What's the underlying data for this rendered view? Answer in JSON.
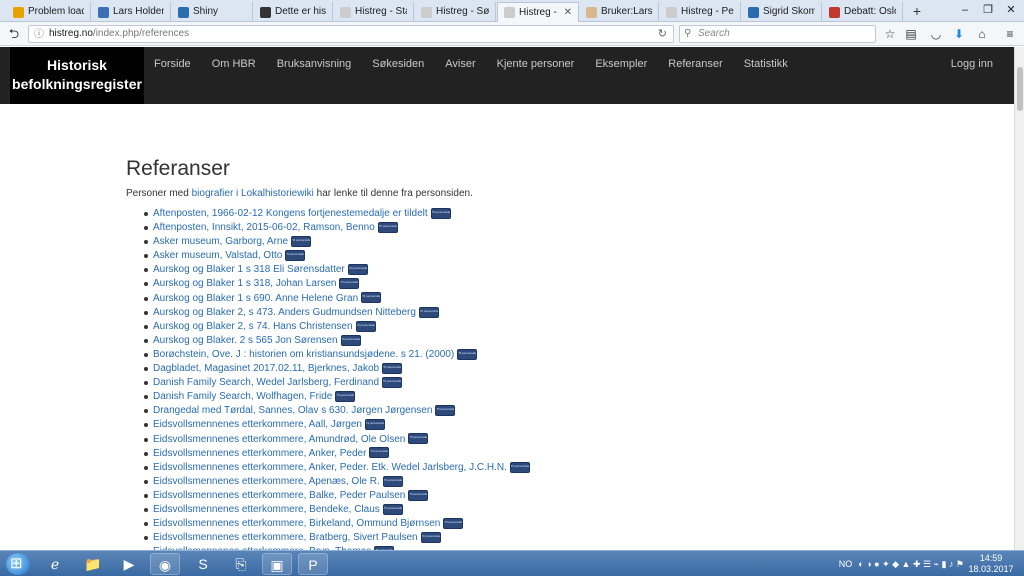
{
  "browser": {
    "tabs": [
      {
        "label": "Problem load…",
        "color": "#e8a200"
      },
      {
        "label": "Lars Holden -…",
        "color": "#3b6fb6"
      },
      {
        "label": "Shiny",
        "color": "#2a6cb0"
      },
      {
        "label": "Dette er histo…",
        "color": "#333333"
      },
      {
        "label": "Histreg - Statistikk",
        "color": "#cccccc"
      },
      {
        "label": "Histreg - Søkeres…",
        "color": "#cccccc"
      },
      {
        "label": "Histreg - Refer…",
        "color": "#cccccc"
      },
      {
        "label": "Bruker:Lars H…",
        "color": "#d9b98a"
      },
      {
        "label": "Histreg - Personsi…",
        "color": "#cccccc"
      },
      {
        "label": "Sigrid Skome…",
        "color": "#2a6cb0"
      },
      {
        "label": "Debatt: Oslo …",
        "color": "#c0392b"
      }
    ],
    "active_tab_index": 6,
    "new_tab_symbol": "+",
    "url_host": "histreg.no",
    "url_path": "/index.php/references",
    "search_placeholder": "Search"
  },
  "site": {
    "brand_line1": "Historisk",
    "brand_line2": "befolkningsregister",
    "nav": [
      "Forside",
      "Om HBR",
      "Bruksanvisning",
      "Søkesiden",
      "Aviser",
      "Kjente personer",
      "Eksempler",
      "Referanser",
      "Statistikk"
    ],
    "login": "Logg inn"
  },
  "page": {
    "title": "Referanser",
    "intro_before": "Personer med ",
    "intro_link": "biografier i Lokalhistoriewiki",
    "intro_after": " har lenke til denne fra personsiden.",
    "tag_label": "Til personside",
    "references": [
      "Aftenposten, 1966-02-12 Kongens fortjenestemedalje er tildelt",
      "Aftenposten, Innsikt, 2015-06-02, Ramson, Benno",
      "Asker museum, Garborg, Arne",
      "Asker museum, Valstad, Otto",
      "Aurskog og Blaker 1 s 318 Eli Sørensdatter",
      "Aurskog og Blaker 1 s 318, Johan Larsen",
      "Aurskog og Blaker 1 s 690. Anne Helene Gran",
      "Aurskog og Blaker 2, s 473. Anders Gudmundsen Nitteberg",
      "Aurskog og Blaker 2, s 74. Hans Christensen",
      "Aurskog og Blaker. 2 s 565 Jon Sørensen",
      "Borøchstein, Ove. J : historien om kristiansundsjødene. s 21. (2000)",
      "Dagbladet, Magasinet 2017.02.11, Bjerknes, Jakob",
      "Danish Family Search, Wedel Jarlsberg, Ferdinand",
      "Danish Family Search, Wolfhagen, Fride",
      "Drangedal med Tørdal, Sannes, Olav s 630. Jørgen Jørgensen",
      "Eidsvollsmennenes etterkommere, Aall, Jørgen",
      "Eidsvollsmennenes etterkommere, Amundrød, Ole Olsen",
      "Eidsvollsmennenes etterkommere, Anker, Peder",
      "Eidsvollsmennenes etterkommere, Anker, Peder. Etk. Wedel Jarlsberg, J.C.H.N.",
      "Eidsvollsmennenes etterkommere, Apenæs, Ole R.",
      "Eidsvollsmennenes etterkommere, Balke, Peder Paulsen",
      "Eidsvollsmennenes etterkommere, Bendeke, Claus",
      "Eidsvollsmennenes etterkommere, Birkeland, Ommund Bjørnsen",
      "Eidsvollsmennenes etterkommere, Bratberg, Sivert Paulsen",
      "Eidsvollsmennenes etterkommere, Bryn, Thomas"
    ]
  },
  "taskbar": {
    "lang": "NO",
    "time": "14:59",
    "date": "18.03.2017"
  }
}
